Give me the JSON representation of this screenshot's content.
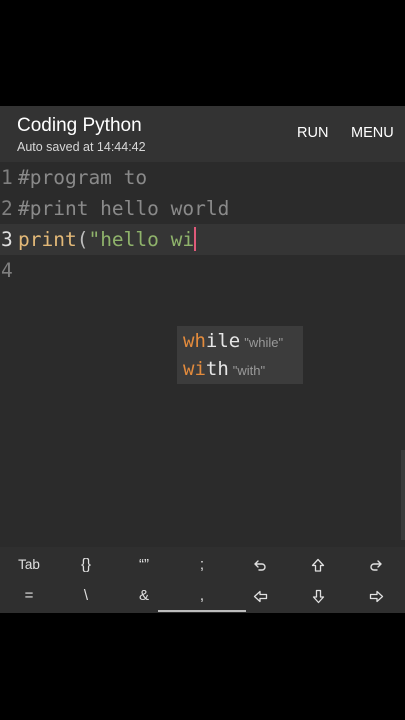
{
  "app": {
    "title": "Coding Python",
    "subtitle": "Auto saved at 14:44:42",
    "actions": [
      "RUN",
      "MENU"
    ]
  },
  "editor": {
    "lines": [
      {
        "num": "1",
        "text": "#program to"
      },
      {
        "num": "2",
        "text": "#print hello world"
      },
      {
        "num": "3",
        "fn": "print",
        "paren": "(",
        "str": "\"hello wi"
      },
      {
        "num": "4",
        "text": ""
      }
    ]
  },
  "autocomplete": [
    {
      "match": "wh",
      "rest": "ile",
      "desc": "\"while\""
    },
    {
      "match": "wi",
      "rest": "th",
      "desc": "\"with\""
    }
  ],
  "keys": {
    "row1": {
      "tab": "Tab",
      "braces": "{}",
      "quotes": "“”",
      "semicolon": ";"
    },
    "row2": {
      "equals": "=",
      "backslash": "\\",
      "ampersand": "&",
      "comma": ","
    }
  },
  "icons": [
    "undo-icon",
    "shift-up-icon",
    "redo-icon",
    "arrow-left-icon",
    "arrow-down-icon",
    "arrow-right-icon"
  ],
  "colors": {
    "comment": "#8a8a8a",
    "function": "#e3b978",
    "string": "#8fb36b",
    "cursor": "#e05a7a",
    "autocomplete_match": "#e38b3c"
  }
}
